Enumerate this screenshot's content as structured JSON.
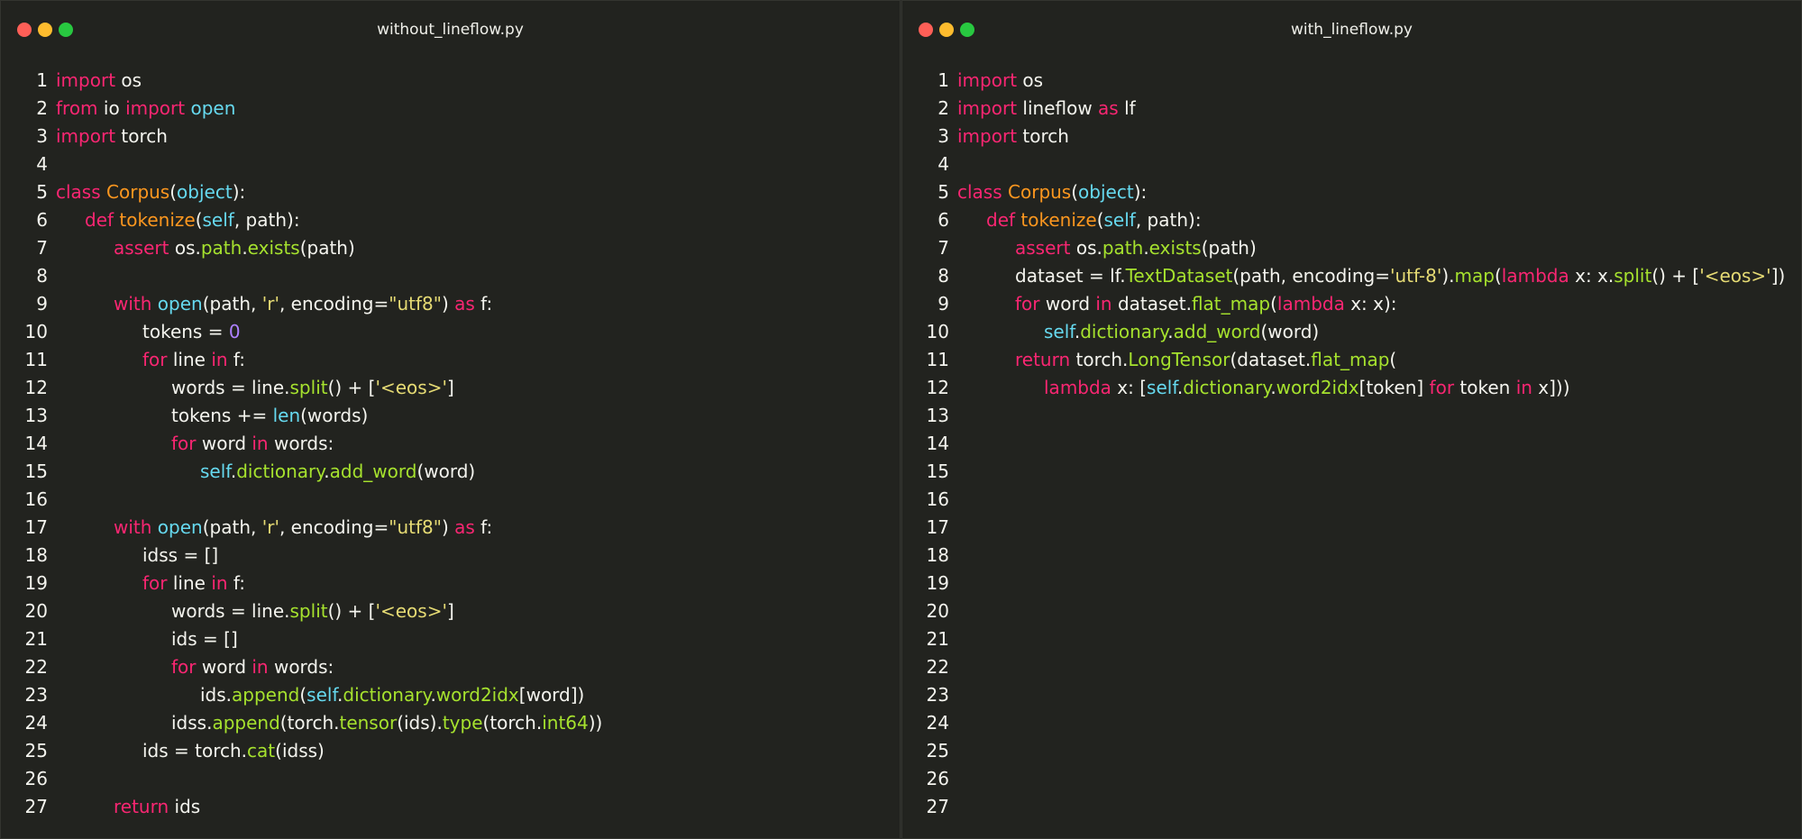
{
  "colors": {
    "background": "#22231f",
    "keyword": "#f92672",
    "name": "#fd971f",
    "builtin": "#66d9ef",
    "string": "#e6db74",
    "number": "#ae81ff",
    "attribute": "#a6e22e",
    "plain": "#f4f4ee"
  },
  "windows": [
    {
      "title": "without_lineflow.py",
      "lines": [
        {
          "n": "1",
          "indent": 0,
          "tokens": [
            [
              "import",
              "k"
            ],
            [
              " os",
              "p"
            ]
          ]
        },
        {
          "n": "2",
          "indent": 0,
          "tokens": [
            [
              "from",
              "k"
            ],
            [
              " io ",
              "p"
            ],
            [
              "import",
              "k"
            ],
            [
              " open",
              "b"
            ]
          ]
        },
        {
          "n": "3",
          "indent": 0,
          "tokens": [
            [
              "import",
              "k"
            ],
            [
              " torch",
              "p"
            ]
          ]
        },
        {
          "n": "4",
          "indent": 0,
          "tokens": []
        },
        {
          "n": "5",
          "indent": 0,
          "tokens": [
            [
              "class",
              "k"
            ],
            [
              " Corpus",
              "cls"
            ],
            [
              "(",
              "p"
            ],
            [
              "object",
              "b"
            ],
            [
              "):",
              "p"
            ]
          ]
        },
        {
          "n": "6",
          "indent": 1,
          "tokens": [
            [
              "def",
              "k"
            ],
            [
              " tokenize",
              "cls"
            ],
            [
              "(",
              "p"
            ],
            [
              "self",
              "b"
            ],
            [
              ", path):",
              "p"
            ]
          ]
        },
        {
          "n": "7",
          "indent": 2,
          "tokens": [
            [
              "assert",
              "k"
            ],
            [
              " os.",
              "p"
            ],
            [
              "path",
              "a"
            ],
            [
              ".",
              "p"
            ],
            [
              "exists",
              "a"
            ],
            [
              "(path)",
              "p"
            ]
          ]
        },
        {
          "n": "8",
          "indent": 0,
          "tokens": []
        },
        {
          "n": "9",
          "indent": 2,
          "tokens": [
            [
              "with",
              "k"
            ],
            [
              " ",
              "p"
            ],
            [
              "open",
              "b"
            ],
            [
              "(path, ",
              "p"
            ],
            [
              "'r'",
              "s"
            ],
            [
              ", encoding=",
              "p"
            ],
            [
              "\"utf8\"",
              "s"
            ],
            [
              ") ",
              "p"
            ],
            [
              "as",
              "k"
            ],
            [
              " f:",
              "p"
            ]
          ]
        },
        {
          "n": "10",
          "indent": 3,
          "tokens": [
            [
              "tokens = ",
              "p"
            ],
            [
              "0",
              "n"
            ]
          ]
        },
        {
          "n": "11",
          "indent": 3,
          "tokens": [
            [
              "for",
              "k"
            ],
            [
              " line ",
              "p"
            ],
            [
              "in",
              "k"
            ],
            [
              " f:",
              "p"
            ]
          ]
        },
        {
          "n": "12",
          "indent": 4,
          "tokens": [
            [
              "words = line.",
              "p"
            ],
            [
              "split",
              "a"
            ],
            [
              "() + [",
              "p"
            ],
            [
              "'<eos>'",
              "s"
            ],
            [
              "]",
              "p"
            ]
          ]
        },
        {
          "n": "13",
          "indent": 4,
          "tokens": [
            [
              "tokens += ",
              "p"
            ],
            [
              "len",
              "b"
            ],
            [
              "(words)",
              "p"
            ]
          ]
        },
        {
          "n": "14",
          "indent": 4,
          "tokens": [
            [
              "for",
              "k"
            ],
            [
              " word ",
              "p"
            ],
            [
              "in",
              "k"
            ],
            [
              " words:",
              "p"
            ]
          ]
        },
        {
          "n": "15",
          "indent": 5,
          "tokens": [
            [
              "self",
              "b"
            ],
            [
              ".",
              "p"
            ],
            [
              "dictionary",
              "a"
            ],
            [
              ".",
              "p"
            ],
            [
              "add_word",
              "a"
            ],
            [
              "(word)",
              "p"
            ]
          ]
        },
        {
          "n": "16",
          "indent": 0,
          "tokens": []
        },
        {
          "n": "17",
          "indent": 2,
          "tokens": [
            [
              "with",
              "k"
            ],
            [
              " ",
              "p"
            ],
            [
              "open",
              "b"
            ],
            [
              "(path, ",
              "p"
            ],
            [
              "'r'",
              "s"
            ],
            [
              ", encoding=",
              "p"
            ],
            [
              "\"utf8\"",
              "s"
            ],
            [
              ") ",
              "p"
            ],
            [
              "as",
              "k"
            ],
            [
              " f:",
              "p"
            ]
          ]
        },
        {
          "n": "18",
          "indent": 3,
          "tokens": [
            [
              "idss = []",
              "p"
            ]
          ]
        },
        {
          "n": "19",
          "indent": 3,
          "tokens": [
            [
              "for",
              "k"
            ],
            [
              " line ",
              "p"
            ],
            [
              "in",
              "k"
            ],
            [
              " f:",
              "p"
            ]
          ]
        },
        {
          "n": "20",
          "indent": 4,
          "tokens": [
            [
              "words = line.",
              "p"
            ],
            [
              "split",
              "a"
            ],
            [
              "() + [",
              "p"
            ],
            [
              "'<eos>'",
              "s"
            ],
            [
              "]",
              "p"
            ]
          ]
        },
        {
          "n": "21",
          "indent": 4,
          "tokens": [
            [
              "ids = []",
              "p"
            ]
          ]
        },
        {
          "n": "22",
          "indent": 4,
          "tokens": [
            [
              "for",
              "k"
            ],
            [
              " word ",
              "p"
            ],
            [
              "in",
              "k"
            ],
            [
              " words:",
              "p"
            ]
          ]
        },
        {
          "n": "23",
          "indent": 5,
          "tokens": [
            [
              "ids.",
              "p"
            ],
            [
              "append",
              "a"
            ],
            [
              "(",
              "p"
            ],
            [
              "self",
              "b"
            ],
            [
              ".",
              "p"
            ],
            [
              "dictionary",
              "a"
            ],
            [
              ".",
              "p"
            ],
            [
              "word2idx",
              "a"
            ],
            [
              "[word])",
              "p"
            ]
          ]
        },
        {
          "n": "24",
          "indent": 4,
          "tokens": [
            [
              "idss.",
              "p"
            ],
            [
              "append",
              "a"
            ],
            [
              "(torch.",
              "p"
            ],
            [
              "tensor",
              "a"
            ],
            [
              "(ids).",
              "p"
            ],
            [
              "type",
              "a"
            ],
            [
              "(torch.",
              "p"
            ],
            [
              "int64",
              "a"
            ],
            [
              "))",
              "p"
            ]
          ]
        },
        {
          "n": "25",
          "indent": 3,
          "tokens": [
            [
              "ids = torch.",
              "p"
            ],
            [
              "cat",
              "a"
            ],
            [
              "(idss)",
              "p"
            ]
          ]
        },
        {
          "n": "26",
          "indent": 0,
          "tokens": []
        },
        {
          "n": "27",
          "indent": 2,
          "tokens": [
            [
              "return",
              "k"
            ],
            [
              " ids",
              "p"
            ]
          ]
        }
      ]
    },
    {
      "title": "with_lineflow.py",
      "lines": [
        {
          "n": "1",
          "indent": 0,
          "tokens": [
            [
              "import",
              "k"
            ],
            [
              " os",
              "p"
            ]
          ]
        },
        {
          "n": "2",
          "indent": 0,
          "tokens": [
            [
              "import",
              "k"
            ],
            [
              " lineflow ",
              "p"
            ],
            [
              "as",
              "k"
            ],
            [
              " lf",
              "p"
            ]
          ]
        },
        {
          "n": "3",
          "indent": 0,
          "tokens": [
            [
              "import",
              "k"
            ],
            [
              " torch",
              "p"
            ]
          ]
        },
        {
          "n": "4",
          "indent": 0,
          "tokens": []
        },
        {
          "n": "5",
          "indent": 0,
          "tokens": [
            [
              "class",
              "k"
            ],
            [
              " Corpus",
              "cls"
            ],
            [
              "(",
              "p"
            ],
            [
              "object",
              "b"
            ],
            [
              "):",
              "p"
            ]
          ]
        },
        {
          "n": "6",
          "indent": 1,
          "tokens": [
            [
              "def",
              "k"
            ],
            [
              " tokenize",
              "cls"
            ],
            [
              "(",
              "p"
            ],
            [
              "self",
              "b"
            ],
            [
              ", path):",
              "p"
            ]
          ]
        },
        {
          "n": "7",
          "indent": 2,
          "tokens": [
            [
              "assert",
              "k"
            ],
            [
              " os.",
              "p"
            ],
            [
              "path",
              "a"
            ],
            [
              ".",
              "p"
            ],
            [
              "exists",
              "a"
            ],
            [
              "(path)",
              "p"
            ]
          ]
        },
        {
          "n": "8",
          "indent": 2,
          "tokens": [
            [
              "dataset = lf.",
              "p"
            ],
            [
              "TextDataset",
              "a"
            ],
            [
              "(path, encoding=",
              "p"
            ],
            [
              "'utf-8'",
              "s"
            ],
            [
              ").",
              "p"
            ],
            [
              "map",
              "a"
            ],
            [
              "(",
              "p"
            ],
            [
              "lambda",
              "k"
            ],
            [
              " x: x.",
              "p"
            ],
            [
              "split",
              "a"
            ],
            [
              "() + [",
              "p"
            ],
            [
              "'<eos>'",
              "s"
            ],
            [
              "])",
              "p"
            ]
          ]
        },
        {
          "n": "9",
          "indent": 2,
          "tokens": [
            [
              "for",
              "k"
            ],
            [
              " word ",
              "p"
            ],
            [
              "in",
              "k"
            ],
            [
              " dataset.",
              "p"
            ],
            [
              "flat_map",
              "a"
            ],
            [
              "(",
              "p"
            ],
            [
              "lambda",
              "k"
            ],
            [
              " x: x):",
              "p"
            ]
          ]
        },
        {
          "n": "10",
          "indent": 3,
          "tokens": [
            [
              "self",
              "b"
            ],
            [
              ".",
              "p"
            ],
            [
              "dictionary",
              "a"
            ],
            [
              ".",
              "p"
            ],
            [
              "add_word",
              "a"
            ],
            [
              "(word)",
              "p"
            ]
          ]
        },
        {
          "n": "11",
          "indent": 2,
          "tokens": [
            [
              "return",
              "k"
            ],
            [
              " torch.",
              "p"
            ],
            [
              "LongTensor",
              "a"
            ],
            [
              "(dataset.",
              "p"
            ],
            [
              "flat_map",
              "a"
            ],
            [
              "(",
              "p"
            ]
          ]
        },
        {
          "n": "12",
          "indent": 3,
          "tokens": [
            [
              "lambda",
              "k"
            ],
            [
              " x: [",
              "p"
            ],
            [
              "self",
              "b"
            ],
            [
              ".",
              "p"
            ],
            [
              "dictionary",
              "a"
            ],
            [
              ".",
              "p"
            ],
            [
              "word2idx",
              "a"
            ],
            [
              "[token] ",
              "p"
            ],
            [
              "for",
              "k"
            ],
            [
              " token ",
              "p"
            ],
            [
              "in",
              "k"
            ],
            [
              " x]))",
              "p"
            ]
          ]
        },
        {
          "n": "13",
          "indent": 0,
          "tokens": []
        },
        {
          "n": "14",
          "indent": 0,
          "tokens": []
        },
        {
          "n": "15",
          "indent": 0,
          "tokens": []
        },
        {
          "n": "16",
          "indent": 0,
          "tokens": []
        },
        {
          "n": "17",
          "indent": 0,
          "tokens": []
        },
        {
          "n": "18",
          "indent": 0,
          "tokens": []
        },
        {
          "n": "19",
          "indent": 0,
          "tokens": []
        },
        {
          "n": "20",
          "indent": 0,
          "tokens": []
        },
        {
          "n": "21",
          "indent": 0,
          "tokens": []
        },
        {
          "n": "22",
          "indent": 0,
          "tokens": []
        },
        {
          "n": "23",
          "indent": 0,
          "tokens": []
        },
        {
          "n": "24",
          "indent": 0,
          "tokens": []
        },
        {
          "n": "25",
          "indent": 0,
          "tokens": []
        },
        {
          "n": "26",
          "indent": 0,
          "tokens": []
        },
        {
          "n": "27",
          "indent": 0,
          "tokens": []
        }
      ]
    }
  ]
}
